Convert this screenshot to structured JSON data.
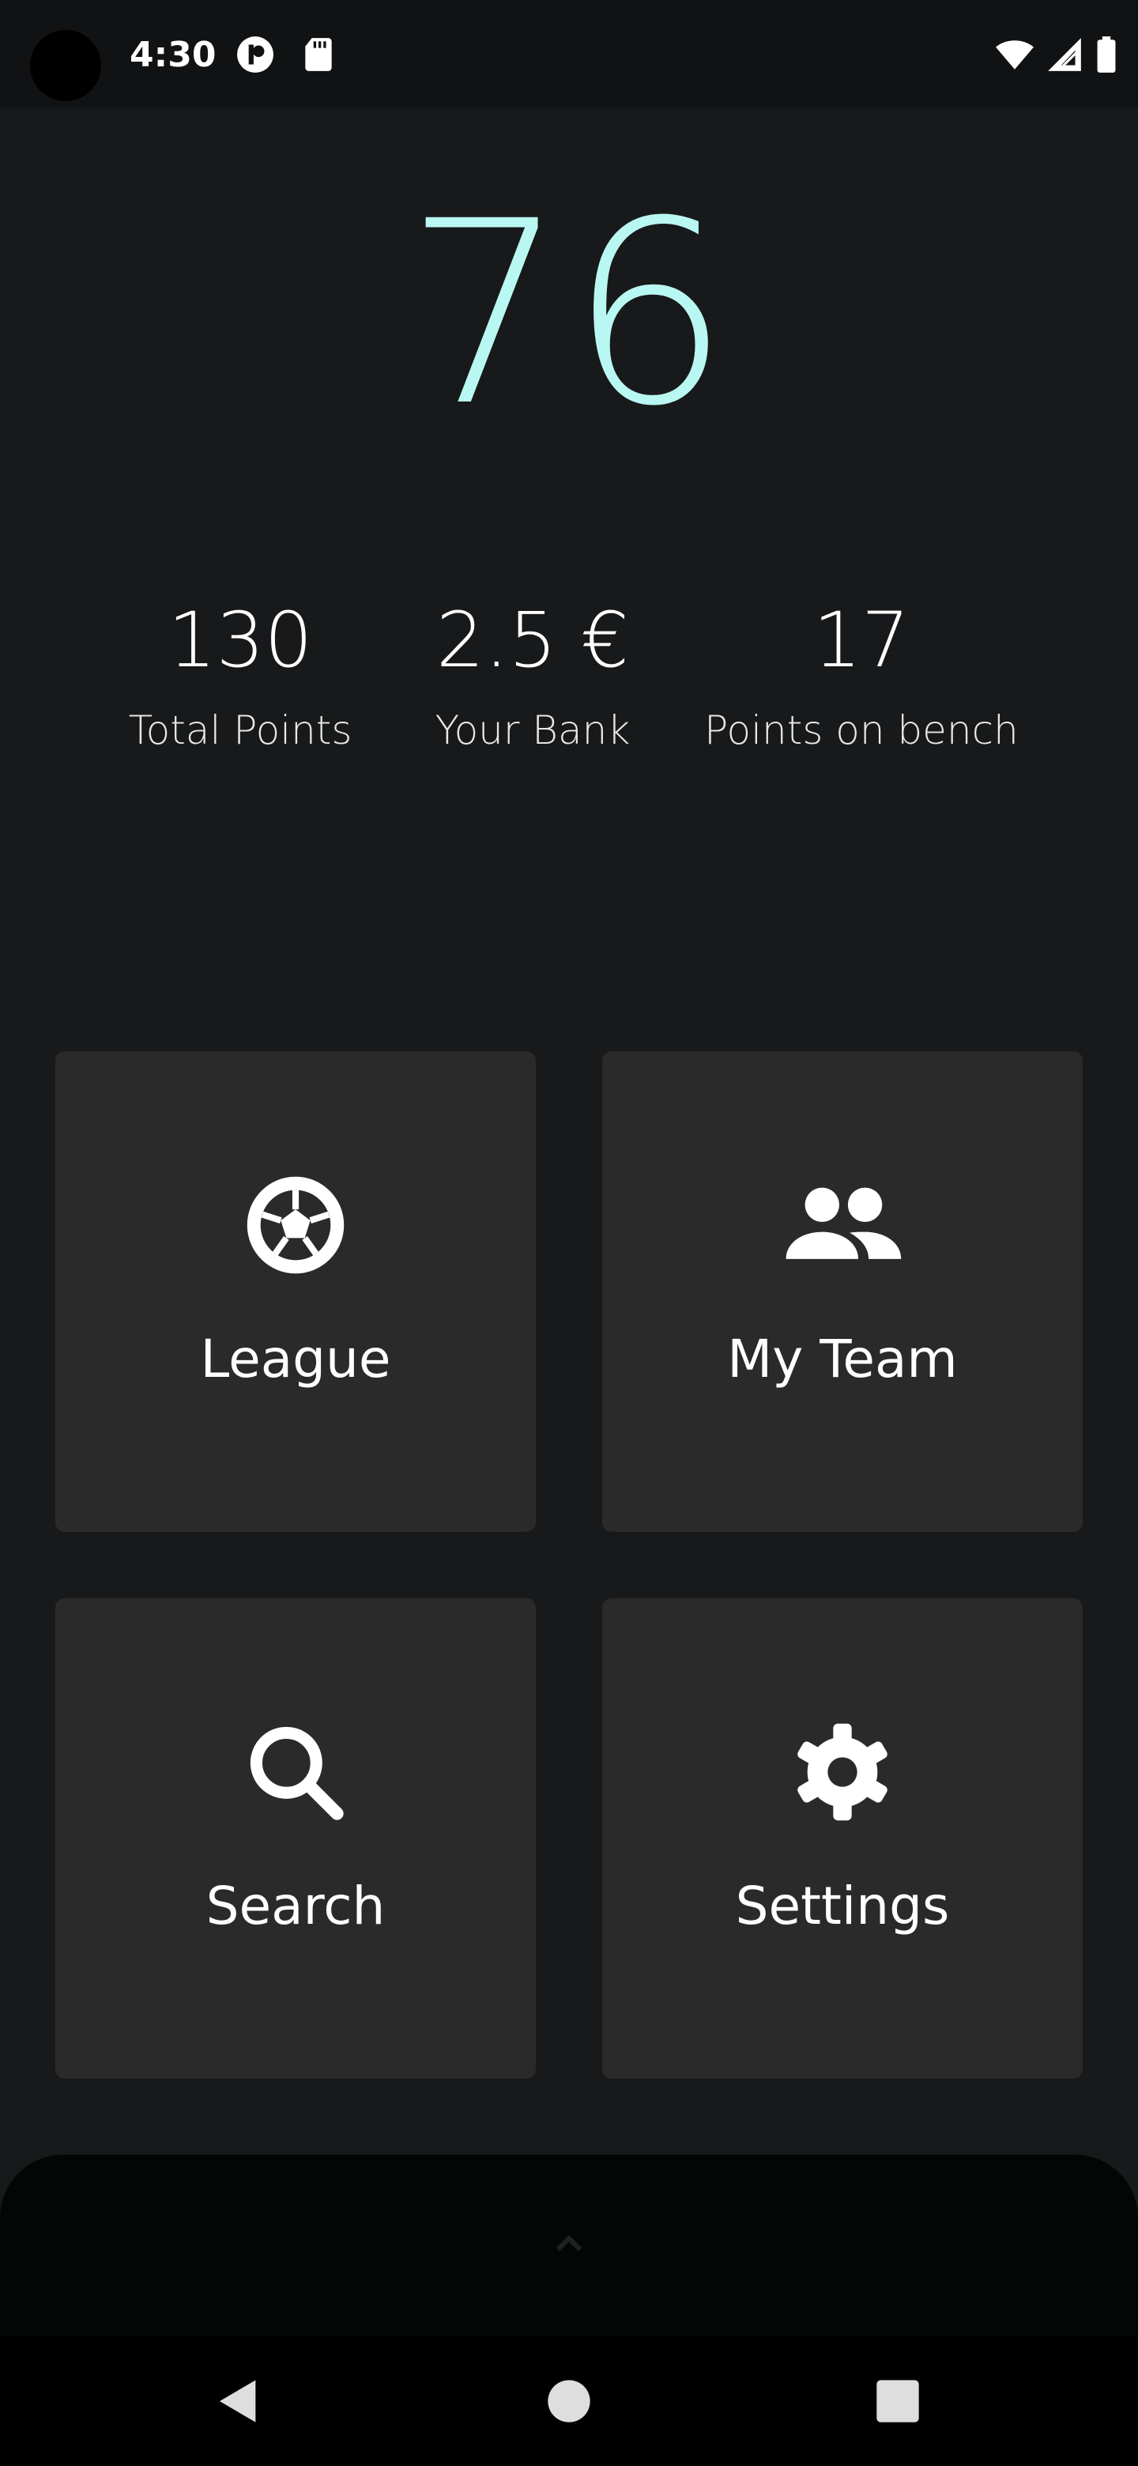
{
  "status_bar": {
    "time": "4:30",
    "icons": [
      "app-notification-icon",
      "sd-card-icon",
      "wifi-icon",
      "cellular-signal-icon",
      "battery-icon"
    ]
  },
  "summary": {
    "gameweek_points": "76",
    "stats": [
      {
        "value": "130",
        "label": "Total Points"
      },
      {
        "value": "2.5 €",
        "label": "Your Bank"
      },
      {
        "value": "17",
        "label": "Points on bench"
      }
    ]
  },
  "menu": {
    "cards": [
      {
        "label": "League",
        "icon": "soccer-ball-icon"
      },
      {
        "label": "My Team",
        "icon": "people-icon"
      },
      {
        "label": "Search",
        "icon": "search-icon"
      },
      {
        "label": "Settings",
        "icon": "gear-icon"
      }
    ]
  },
  "bottom_sheet": {
    "handle_icon": "chevron-up-icon"
  },
  "navigation": {
    "buttons": [
      "back-icon",
      "home-icon",
      "recents-icon"
    ]
  },
  "colors": {
    "background": "#18191a",
    "status_bar": "#111213",
    "card": "#2a2a2b",
    "accent": "#b9f7f2",
    "sheet": "#040606",
    "nav_bar": "#000000"
  }
}
